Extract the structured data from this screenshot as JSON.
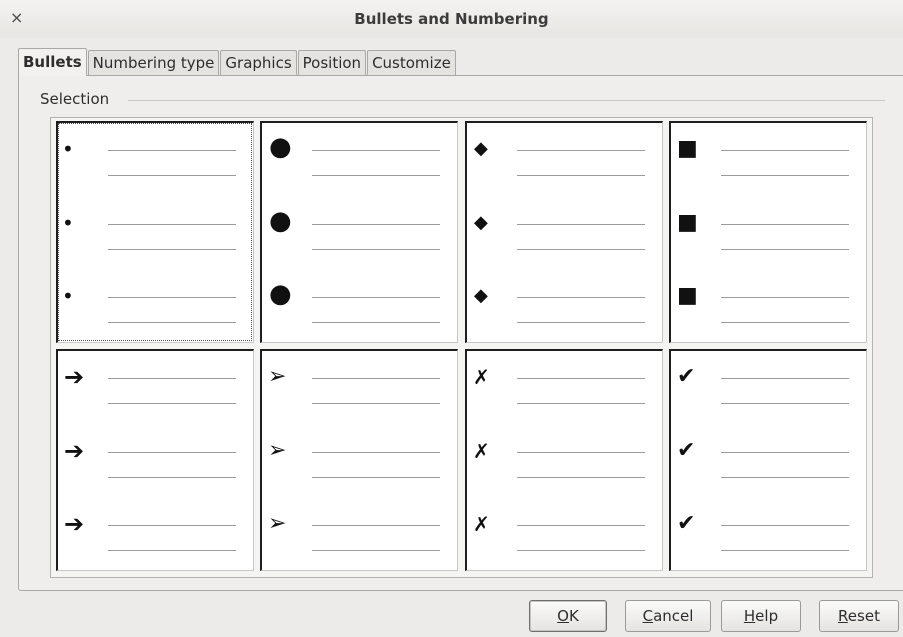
{
  "window": {
    "title": "Bullets and Numbering",
    "close_glyph": "×"
  },
  "tabs": [
    {
      "label": "Bullets",
      "active": true
    },
    {
      "label": "Numbering type",
      "active": false
    },
    {
      "label": "Graphics",
      "active": false
    },
    {
      "label": "Position",
      "active": false
    },
    {
      "label": "Customize",
      "active": false
    }
  ],
  "selection": {
    "label": "Selection",
    "styles": [
      {
        "icon": "small-dot-bullet-icon",
        "glyph": "•"
      },
      {
        "icon": "large-dot-bullet-icon",
        "glyph": "●"
      },
      {
        "icon": "diamond-bullet-icon",
        "glyph": "◆"
      },
      {
        "icon": "square-bullet-icon",
        "glyph": "■"
      },
      {
        "icon": "arrow-bullet-icon",
        "glyph": "➔"
      },
      {
        "icon": "arrowhead-bullet-icon",
        "glyph": "➢"
      },
      {
        "icon": "cross-bullet-icon",
        "glyph": "✗"
      },
      {
        "icon": "check-bullet-icon",
        "glyph": "✔"
      }
    ]
  },
  "buttons": {
    "ok": {
      "mnemonic": "O",
      "rest": "K"
    },
    "cancel": {
      "mnemonic": "C",
      "rest": "ancel"
    },
    "help": {
      "mnemonic": "H",
      "rest": "elp"
    },
    "reset": {
      "mnemonic": "R",
      "rest": "eset"
    }
  },
  "colors": {
    "background": "#ecebe9",
    "cell_background": "#ffffff",
    "bullet": "#111111"
  }
}
